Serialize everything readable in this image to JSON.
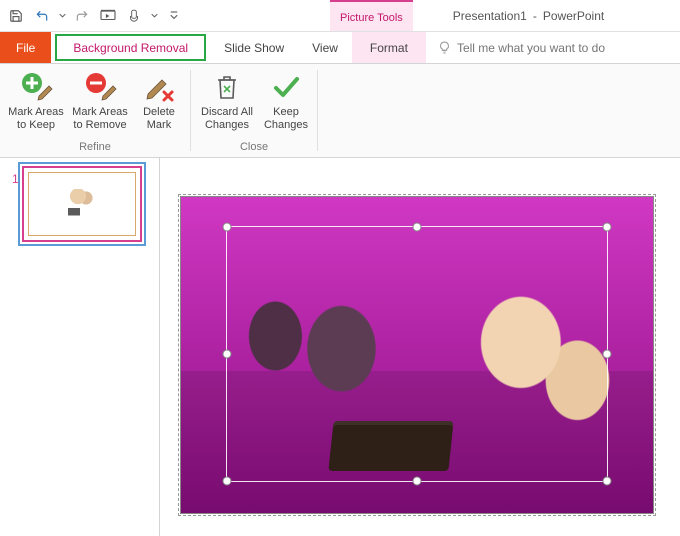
{
  "qat": {
    "save": "save-icon",
    "undo": "undo-icon",
    "redo": "redo-icon",
    "start": "start-from-beginning-icon",
    "customize": "customize-icon"
  },
  "titlebar": {
    "context_tab_group": "Picture Tools",
    "doc_name": "Presentation1",
    "separator": "-",
    "app_name": "PowerPoint"
  },
  "tabs": {
    "file": "File",
    "background_removal": "Background Removal",
    "slide_show": "Slide Show",
    "view": "View",
    "format": "Format",
    "tellme_placeholder": "Tell me what you want to do"
  },
  "ribbon": {
    "refine": {
      "label": "Refine",
      "mark_keep_l1": "Mark Areas",
      "mark_keep_l2": "to Keep",
      "mark_remove_l1": "Mark Areas",
      "mark_remove_l2": "to Remove",
      "delete_l1": "Delete",
      "delete_l2": "Mark"
    },
    "close": {
      "label": "Close",
      "discard_l1": "Discard All",
      "discard_l2": "Changes",
      "keep_l1": "Keep",
      "keep_l2": "Changes"
    }
  },
  "thumbs": {
    "slide1_num": "1"
  }
}
